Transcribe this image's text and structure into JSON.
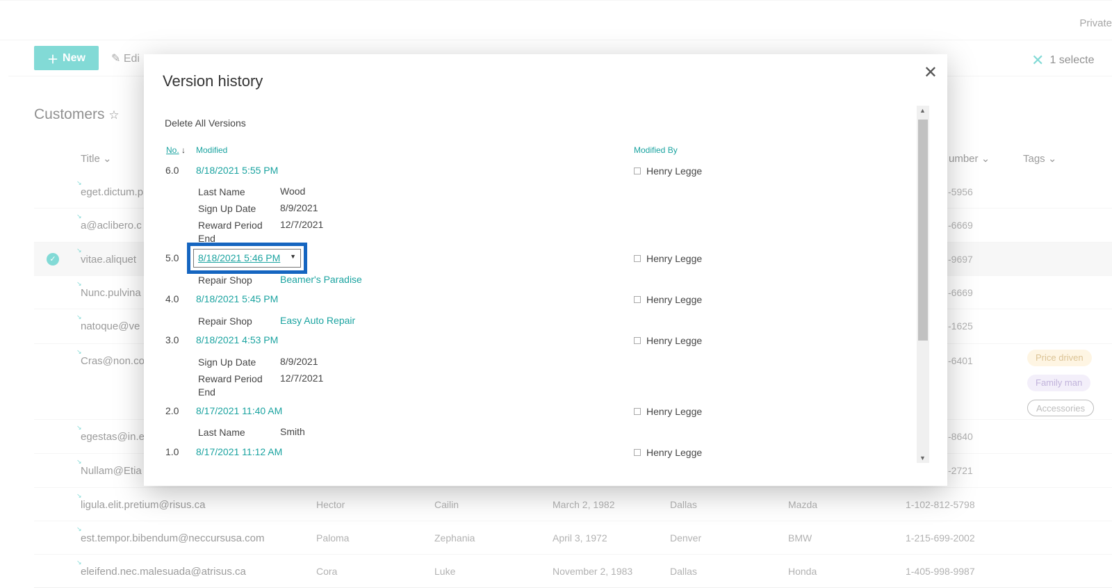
{
  "topbar": {
    "private": "Private"
  },
  "commandbar": {
    "new_label": "New",
    "edit_label": "Edi",
    "selected_label": "1 selecte"
  },
  "list": {
    "title": "Customers",
    "headers": {
      "title": "Title",
      "number": "umber",
      "tags": "Tags"
    },
    "rows": [
      {
        "title": "eget.dictum.p",
        "phone": "-5956"
      },
      {
        "title": "a@aclibero.c",
        "phone": "-6669"
      },
      {
        "title": "vitae.aliquet",
        "phone": "-9697",
        "selected": true
      },
      {
        "title": "Nunc.pulvina",
        "phone": "-6669"
      },
      {
        "title": "natoque@ve",
        "phone": "-1625"
      },
      {
        "title": "Cras@non.co",
        "phone": "-6401",
        "tags": [
          "Price driven",
          "Family man",
          "Accessories"
        ]
      },
      {
        "title": "egestas@in.e",
        "phone": "-8640"
      },
      {
        "title": "Nullam@Etia",
        "phone": "-2721"
      },
      {
        "title": "ligula.elit.pretium@risus.ca",
        "first": "Hector",
        "last": "Cailin",
        "dob": "March 2, 1982",
        "city": "Dallas",
        "car": "Mazda",
        "phone": "1-102-812-5798"
      },
      {
        "title": "est.tempor.bibendum@neccursusa.com",
        "first": "Paloma",
        "last": "Zephania",
        "dob": "April 3, 1972",
        "city": "Denver",
        "car": "BMW",
        "phone": "1-215-699-2002"
      },
      {
        "title": "eleifend.nec.malesuada@atrisus.ca",
        "first": "Cora",
        "last": "Luke",
        "dob": "November 2, 1983",
        "city": "Dallas",
        "car": "Honda",
        "phone": "1-405-998-9987"
      }
    ]
  },
  "dialog": {
    "title": "Version history",
    "delete_all": "Delete All Versions",
    "columns": {
      "no": "No.",
      "modified": "Modified",
      "modified_by": "Modified By"
    },
    "versions": [
      {
        "no": "6.0",
        "date": "8/18/2021 5:55 PM",
        "by": "Henry Legge",
        "fields": [
          [
            "Last Name",
            "Wood"
          ],
          [
            "Sign Up Date",
            "8/9/2021"
          ],
          [
            "Reward Period End",
            "12/7/2021"
          ]
        ]
      },
      {
        "no": "5.0",
        "date": "8/18/2021 5:46 PM",
        "by": "Henry Legge",
        "fields": [
          [
            "Repair Shop",
            "Beamer's Paradise"
          ]
        ]
      },
      {
        "no": "4.0",
        "date": "8/18/2021 5:45 PM",
        "by": "Henry Legge",
        "fields": [
          [
            "Repair Shop",
            "Easy Auto Repair"
          ]
        ]
      },
      {
        "no": "3.0",
        "date": "8/18/2021 4:53 PM",
        "by": "Henry Legge",
        "fields": [
          [
            "Sign Up Date",
            "8/9/2021"
          ],
          [
            "Reward Period End",
            "12/7/2021"
          ]
        ]
      },
      {
        "no": "2.0",
        "date": "8/17/2021 11:40 AM",
        "by": "Henry Legge",
        "fields": [
          [
            "Last Name",
            "Smith"
          ]
        ]
      },
      {
        "no": "1.0",
        "date": "8/17/2021 11:12 AM",
        "by": "Henry Legge",
        "fields": []
      }
    ]
  },
  "colors": {
    "accent": "#3fc6c0",
    "highlight": "#1565c0",
    "tag_price": "#fdf0d5",
    "tag_family": "#ede6f8"
  }
}
